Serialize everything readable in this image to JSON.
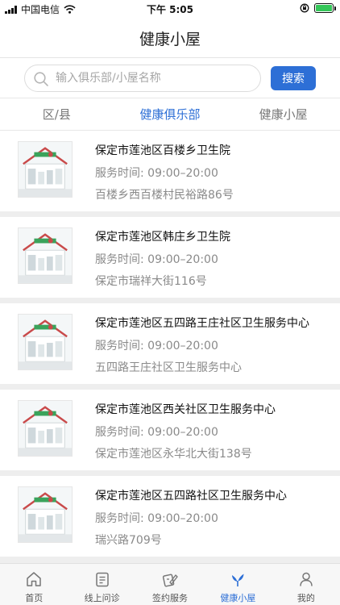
{
  "status_bar": {
    "carrier": "中国电信",
    "time": "下午 5:05"
  },
  "header": {
    "title": "健康小屋"
  },
  "search": {
    "placeholder": "输入俱乐部/小屋名称",
    "value": "",
    "button_label": "搜索"
  },
  "tabs": [
    {
      "label": "区/县",
      "active": false
    },
    {
      "label": "健康俱乐部",
      "active": true
    },
    {
      "label": "健康小屋",
      "active": false
    }
  ],
  "clinics": [
    {
      "name": "保定市莲池区百楼乡卫生院",
      "hours": "服务时间:  09:00–20:00",
      "address": "百楼乡西百楼村民裕路86号"
    },
    {
      "name": "保定市莲池区韩庄乡卫生院",
      "hours": "服务时间:  09:00–20:00",
      "address": "保定市瑞祥大街116号"
    },
    {
      "name": "保定市莲池区五四路王庄社区卫生服务中心",
      "hours": "服务时间:  09:00–20:00",
      "address": "五四路王庄社区卫生服务中心"
    },
    {
      "name": "保定市莲池区西关社区卫生服务中心",
      "hours": "服务时间:  09:00–20:00",
      "address": "保定市莲池区永华北大街138号"
    },
    {
      "name": "保定市莲池区五四路社区卫生服务中心",
      "hours": "服务时间:  09:00–20:00",
      "address": "瑞兴路709号"
    }
  ],
  "bottom_nav": [
    {
      "label": "首页",
      "icon": "home-icon",
      "active": false
    },
    {
      "label": "线上问诊",
      "icon": "clipboard-icon",
      "active": false
    },
    {
      "label": "签约服务",
      "icon": "contract-icon",
      "active": false
    },
    {
      "label": "健康小屋",
      "icon": "leaf-icon",
      "active": true
    },
    {
      "label": "我的",
      "icon": "person-icon",
      "active": false
    }
  ],
  "colors": {
    "accent": "#2d6fd6",
    "battery": "#34c759"
  }
}
